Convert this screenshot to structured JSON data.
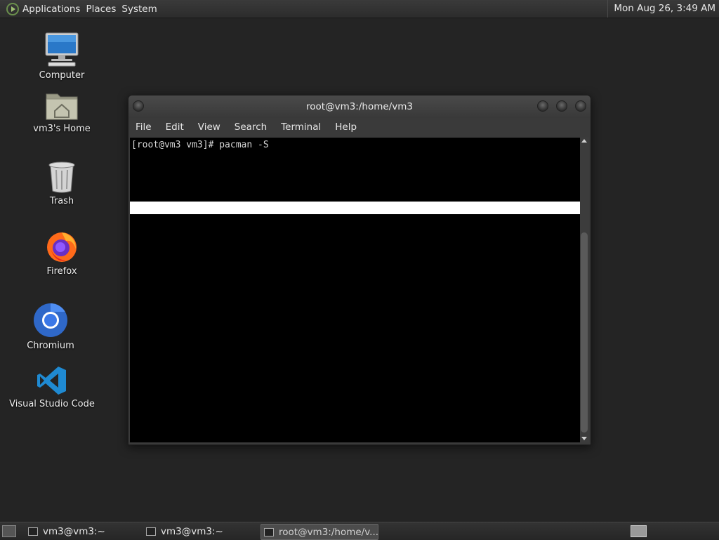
{
  "top_panel": {
    "menus": [
      "Applications",
      "Places",
      "System"
    ],
    "clock": "Mon Aug 26,  3:49 AM"
  },
  "desktop_icons": [
    {
      "label": "Computer",
      "icon": "computer-icon"
    },
    {
      "label": "vm3's Home",
      "icon": "home-folder-icon"
    },
    {
      "label": "Trash",
      "icon": "trash-icon"
    },
    {
      "label": "Firefox",
      "icon": "firefox-icon"
    },
    {
      "label": "Chromium",
      "icon": "chromium-icon"
    },
    {
      "label": "Visual Studio Code",
      "icon": "vscode-icon"
    }
  ],
  "terminal": {
    "title": "root@vm3:/home/vm3",
    "menus": [
      "File",
      "Edit",
      "View",
      "Search",
      "Terminal",
      "Help"
    ],
    "prompt_line": "[root@vm3 vm3]# pacman -S"
  },
  "taskbar": {
    "tasks": [
      {
        "label": "vm3@vm3:~",
        "active": false
      },
      {
        "label": "vm3@vm3:~",
        "active": false
      },
      {
        "label": "root@vm3:/home/v...",
        "active": true
      }
    ]
  },
  "colors": {
    "desktop_bg": "#242424",
    "terminal_bg": "#000000",
    "terminal_text": "#d8d8d8",
    "vscode_blue": "#1f8ad2",
    "chromium_blue": "#3b78e7"
  }
}
